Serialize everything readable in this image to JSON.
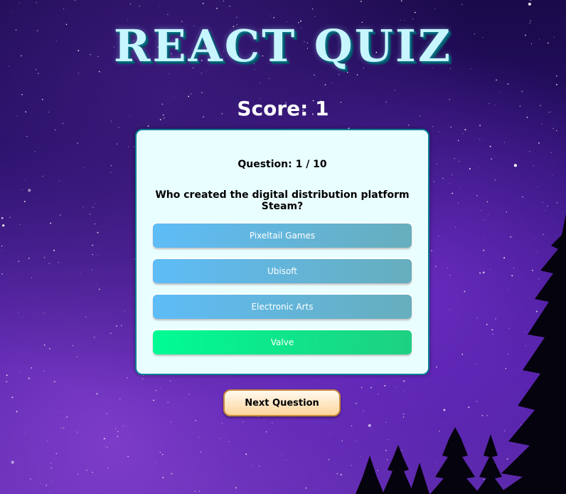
{
  "app": {
    "title": "REACT QUIZ"
  },
  "score": {
    "label": "Score: 1"
  },
  "question": {
    "number_label": "Question: 1 / 10",
    "text": "Who created the digital distribution platform Steam?"
  },
  "answers": [
    {
      "label": "Pixeltail Games",
      "state": "normal"
    },
    {
      "label": "Ubisoft",
      "state": "normal"
    },
    {
      "label": "Electronic Arts",
      "state": "normal"
    },
    {
      "label": "Valve",
      "state": "correct"
    }
  ],
  "next_button": {
    "label": "Next Question"
  },
  "colors": {
    "title": "#c8f6ff",
    "card_background": "#e9feff",
    "card_border": "#0b7d97",
    "answer_normal": "#5ebcf7",
    "answer_correct": "#00fb94",
    "next_button": "#ffd59b"
  }
}
